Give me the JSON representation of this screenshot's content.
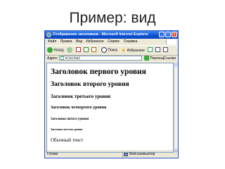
{
  "slide": {
    "title": "Пример: вид"
  },
  "window": {
    "title": "Отображение заголовков - Microsoft Internet Explorer",
    "controls": {
      "minimize": "_",
      "maximize": "□",
      "close": "×"
    }
  },
  "menu": [
    "Файл",
    "Правка",
    "Вид",
    "Избранное",
    "Сервис",
    "Справка"
  ],
  "toolbar": {
    "back_label": "Назад",
    "search_label": "Поиск",
    "favorites_label": "Избранное"
  },
  "address_bar": {
    "label": "Адрес:",
    "value": "D:\\24.html",
    "go_label": "Переход",
    "links_label": "Ссылки"
  },
  "content": {
    "h1": "Заголовок первого уровня",
    "h2": "Заголовок второго уровня",
    "h3": "Заголовок третьего уровня",
    "h4": "Заголовок четвертого уровня",
    "h5": "Заголовок пятого уровня",
    "h6": "Заголовок шестого уровня",
    "paragraph": "Обычный текст"
  },
  "status_bar": {
    "left": "Готово",
    "right": "Мой компьютер"
  },
  "colors": {
    "titlebar": "#0a4fd0",
    "chrome": "#ece9d8",
    "close_button": "#e2562d"
  }
}
